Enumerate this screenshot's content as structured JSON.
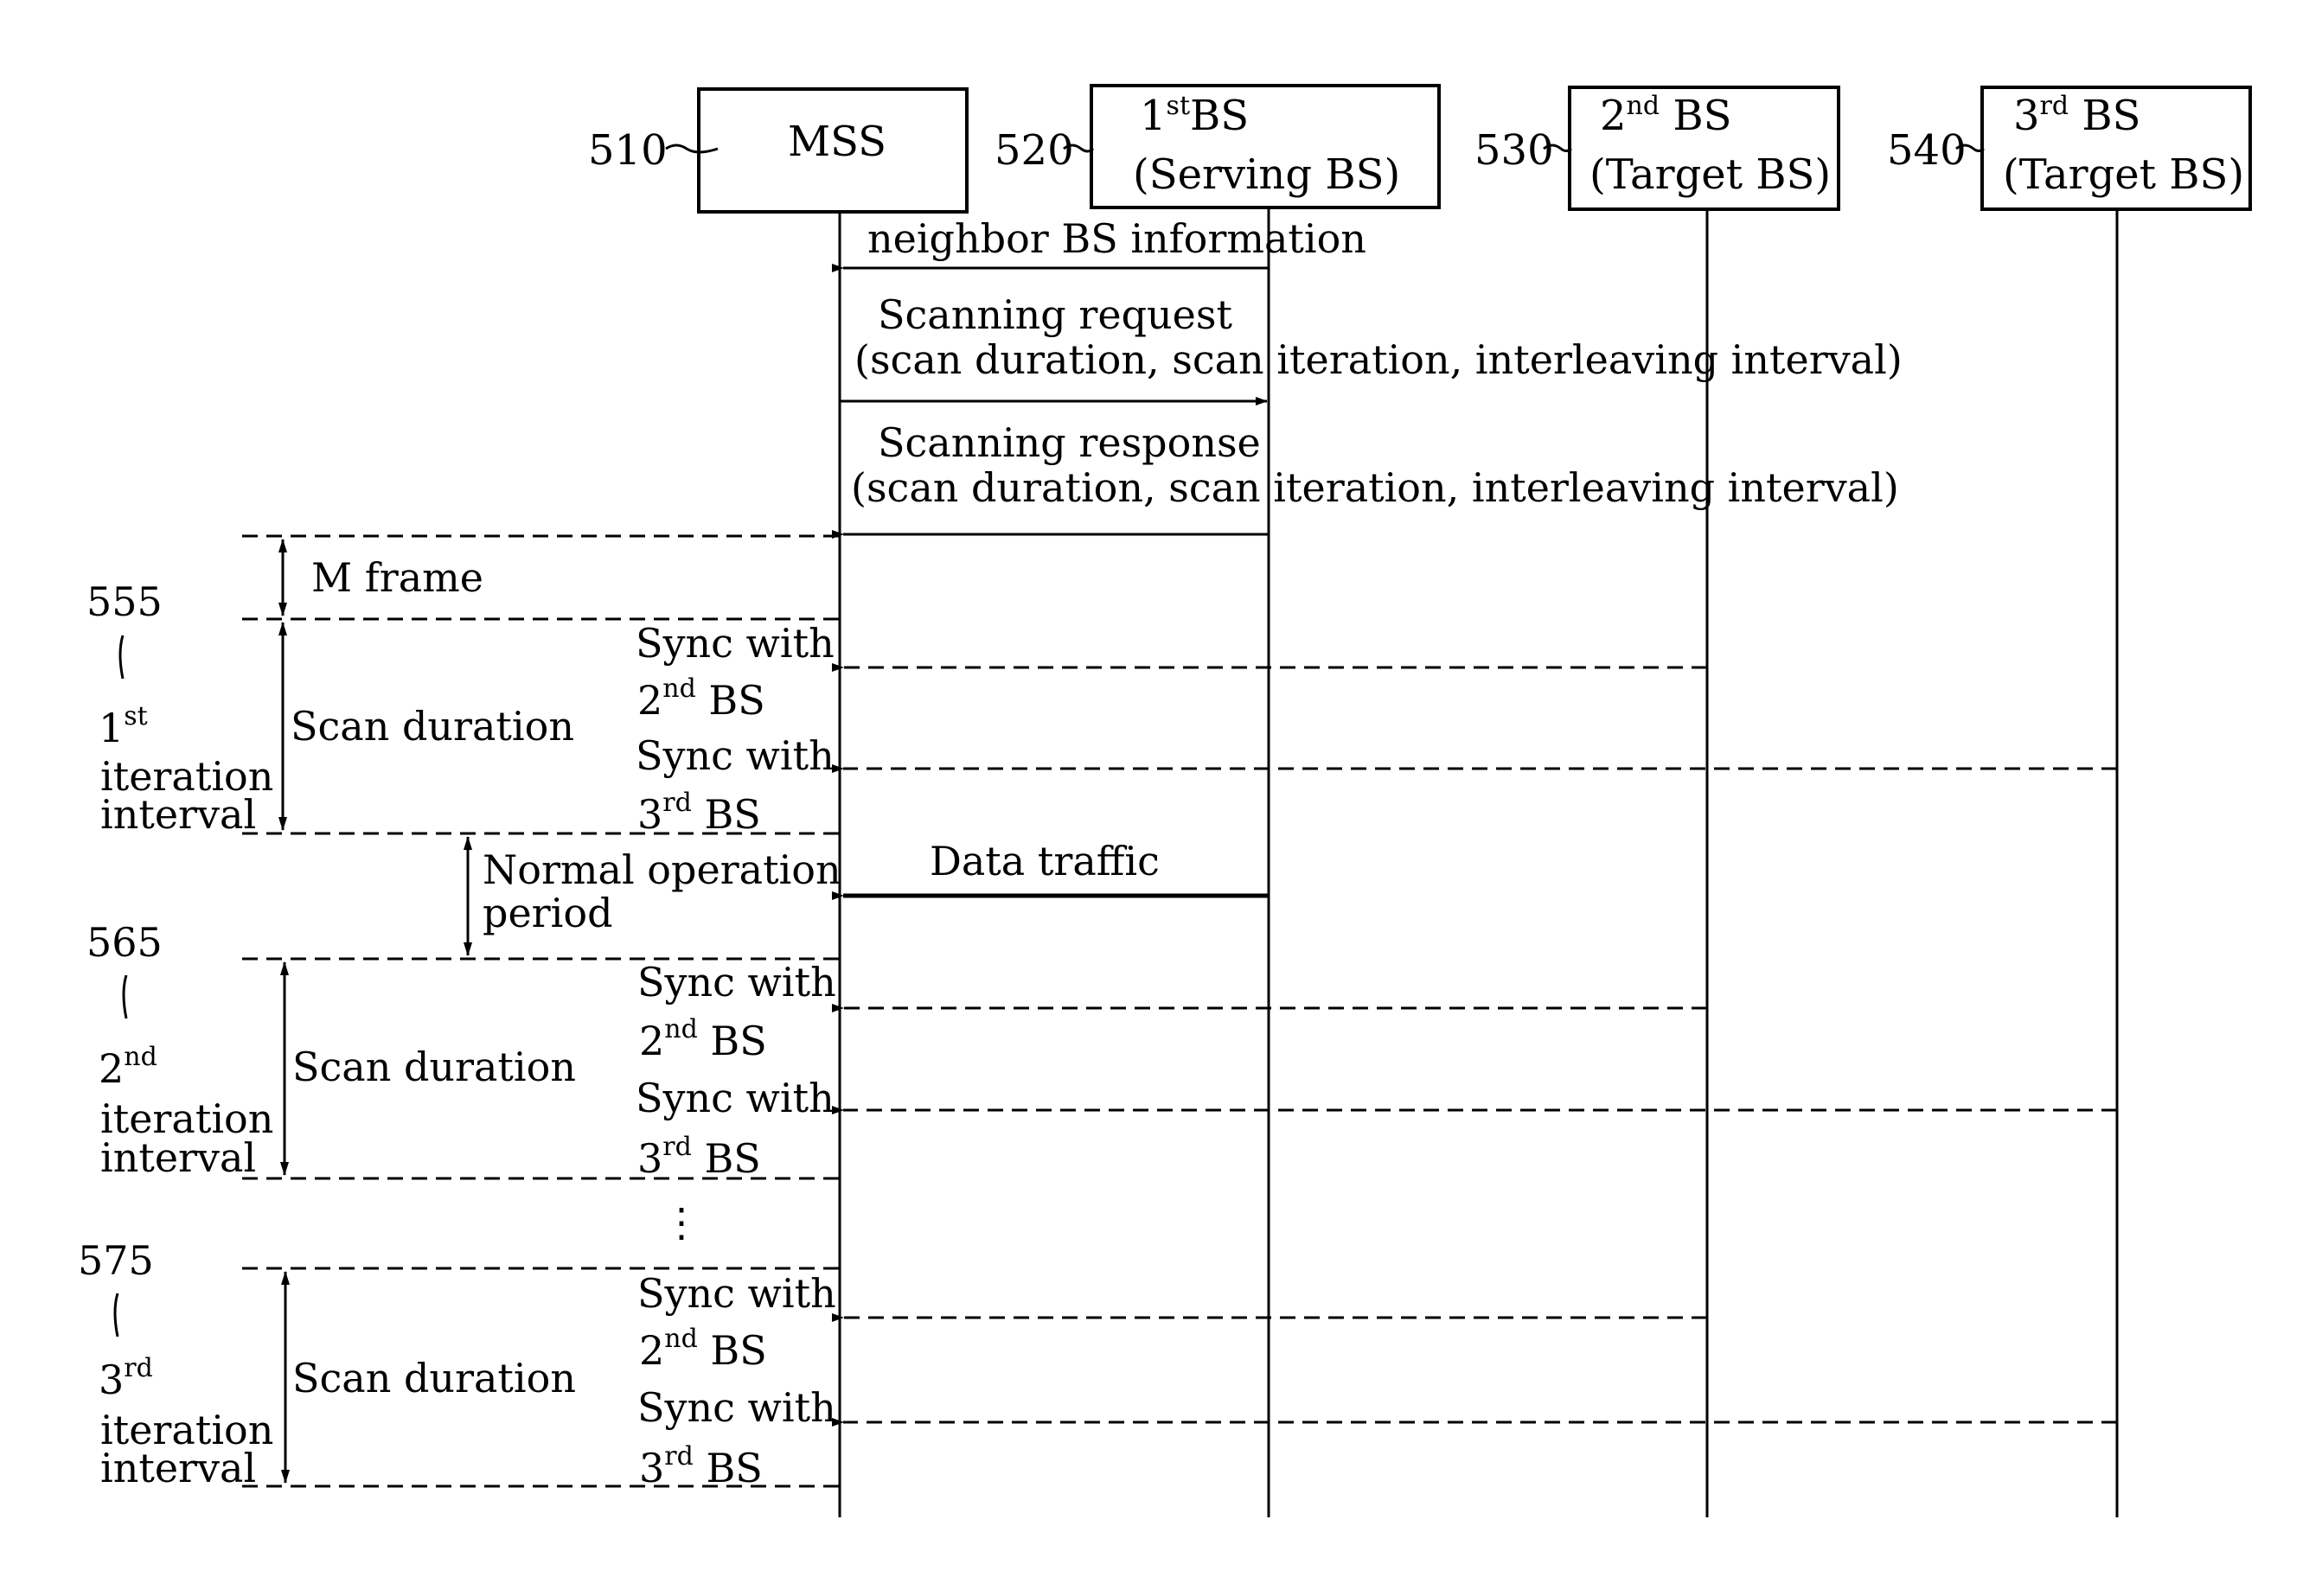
{
  "entities": [
    {
      "ref": "510",
      "line1": "MSS",
      "line1_sup": "",
      "line1_after": "",
      "line2": ""
    },
    {
      "ref": "520",
      "line1": "1",
      "line1_sup": "st",
      "line1_after": "BS",
      "line2": "(Serving BS)"
    },
    {
      "ref": "530",
      "line1": "2",
      "line1_sup": "nd",
      "line1_after": " BS",
      "line2": "(Target BS)"
    },
    {
      "ref": "540",
      "line1": "3",
      "line1_sup": "rd",
      "line1_after": " BS",
      "line2": "(Target BS)"
    }
  ],
  "messages": {
    "neighbor": "neighbor BS information",
    "scan_request": "Scanning request",
    "scan_request_params": "(scan duration, scan iteration, interleaving interval)",
    "scan_response": "Scanning response",
    "scan_response_params": "(scan duration, scan iteration, interleaving interval)",
    "data_traffic": "Data traffic"
  },
  "periods": {
    "m_frame": "M frame",
    "scan_duration": "Scan duration",
    "normal_line1": "Normal operation",
    "normal_line2": "period",
    "sync_with": "Sync with",
    "bs2_num": "2",
    "bs2_sup": "nd",
    "bs2_after": " BS",
    "bs3_num": "3",
    "bs3_sup": "rd",
    "bs3_after": " BS",
    "ellipsis": "⋮"
  },
  "iterations": [
    {
      "ref": "555",
      "num": "1",
      "sup": "st",
      "line2": "iteration",
      "line3": "interval"
    },
    {
      "ref": "565",
      "num": "2",
      "sup": "nd",
      "line2": "iteration",
      "line3": "interval"
    },
    {
      "ref": "575",
      "num": "3",
      "sup": "rd",
      "line2": "iteration",
      "line3": "interval"
    }
  ]
}
